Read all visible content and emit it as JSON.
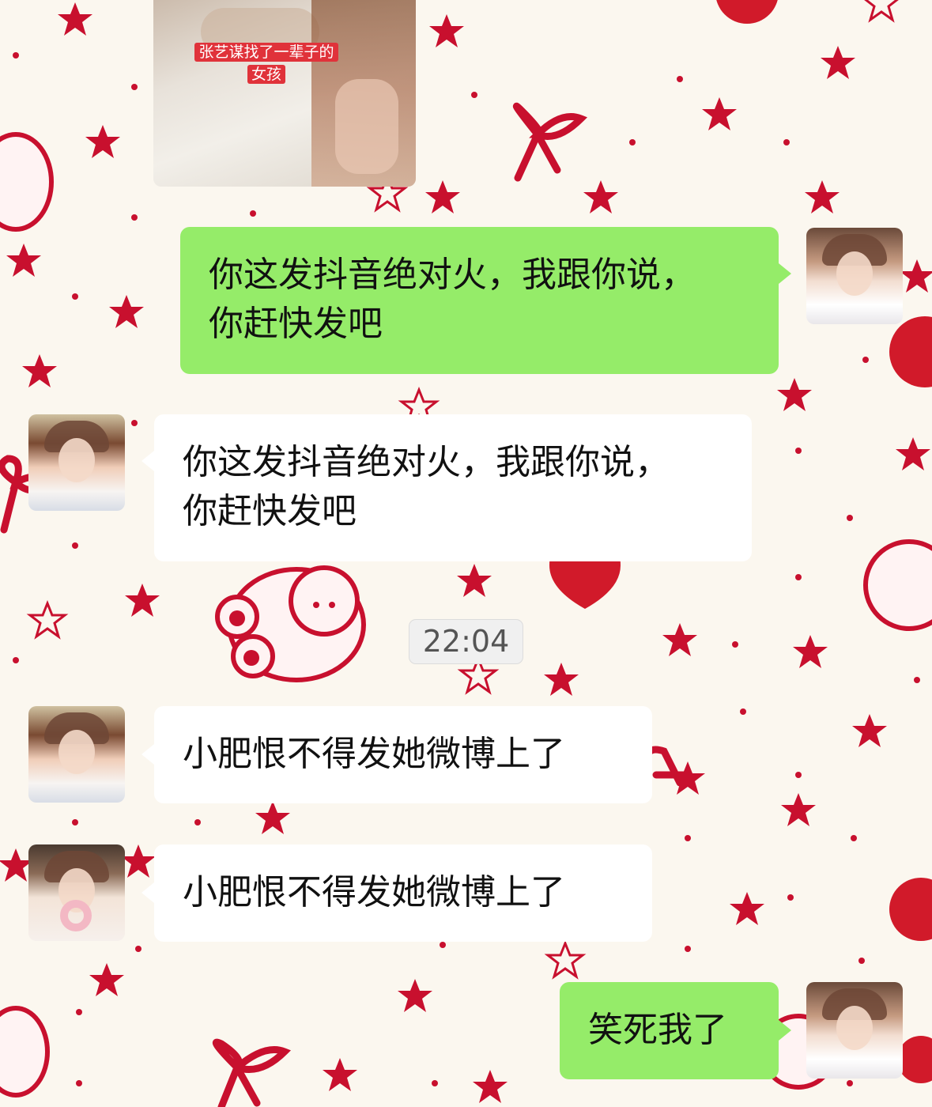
{
  "media": {
    "caption": "张艺谋找了一辈子的女孩"
  },
  "time_divider": "22:04",
  "messages": [
    {
      "side": "right",
      "avatar": "girl-long-hair-avatar",
      "text_line1": "你这发抖音绝对火，我跟你说，",
      "text_line2": "你赶快发吧"
    },
    {
      "side": "left",
      "avatar": "girl-short-hair-avatar",
      "text_line1": "你这发抖音绝对火，我跟你说，",
      "text_line2": "你赶快发吧"
    },
    {
      "side": "left",
      "avatar": "girl-short-hair-avatar",
      "text": "小肥恨不得发她微博上了"
    },
    {
      "side": "left",
      "avatar": "anime-glasses-avatar",
      "text": "小肥恨不得发她微博上了"
    },
    {
      "side": "right",
      "avatar": "girl-long-hair-avatar",
      "text": "笑死我了"
    }
  ],
  "colors": {
    "background": "#fbf7ef",
    "sent_bubble": "#95ec69",
    "received_bubble": "#ffffff",
    "wallpaper_accent": "#c8102e"
  }
}
